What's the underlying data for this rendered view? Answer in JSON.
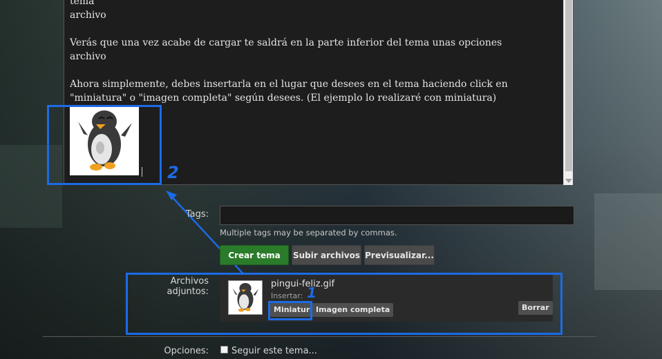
{
  "editor": {
    "paragraphs": [
      "tema\narchivo",
      "Verás que una vez acabe de cargar te saldrá en la parte inferior del tema unas opciones\narchivo",
      "Ahora simplemente, debes insertarla en el lugar que desees en el tema haciendo click en \"miniatura\" o \"imagen completa\" según desees. (El ejemplo lo realizaré con miniatura)"
    ],
    "inserted_image": "penguin-image"
  },
  "annotations": {
    "label_2": "2",
    "label_1": "1",
    "color": "#1c6be6"
  },
  "form": {
    "tags_label": "Tags:",
    "tags_value": "",
    "tags_hint": "Multiple tags may be separated by commas.",
    "buttons": {
      "create": "Crear tema",
      "upload": "Subir archivos",
      "preview": "Previsualizar..."
    },
    "attachments": {
      "label": "Archivos adjuntos:",
      "file_name": "pingui-feliz.gif",
      "insert_label": "Insertar:",
      "thumbnail_button": "Miniatura",
      "full_image_button": "Imagen completa",
      "delete_button": "Borrar"
    },
    "options": {
      "label": "Opciones:",
      "watch_topic": "Seguir este tema...",
      "watch_checked": false
    }
  },
  "colors": {
    "create_button": "#2a7b2a",
    "highlight": "#1c6be6"
  }
}
